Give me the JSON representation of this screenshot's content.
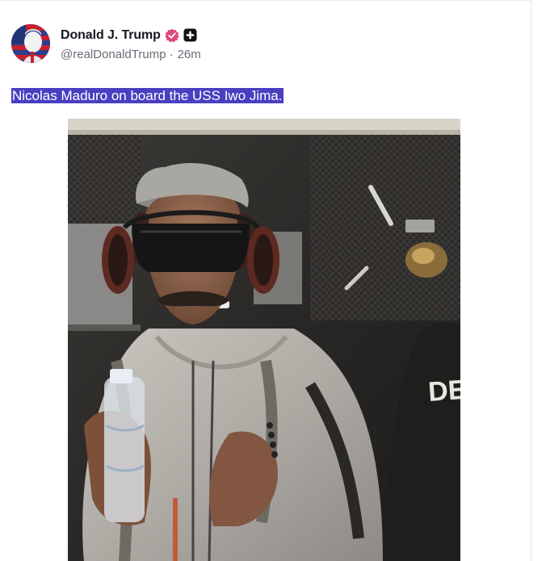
{
  "author": {
    "display_name": "Donald J. Trump",
    "handle": "@realDonaldTrump",
    "time_ago": "26m",
    "separator": "·"
  },
  "icons": {
    "verified": "verified-badge-icon",
    "plus": "plus-badge-icon"
  },
  "post": {
    "text": "Nicolas Maduro on board the USS Iwo Jima.",
    "shirt_text": "DEA"
  },
  "colors": {
    "verified_badge": "#e0497a",
    "text_highlight": "#4a3fc1",
    "handle_gray": "#6b6b78"
  }
}
